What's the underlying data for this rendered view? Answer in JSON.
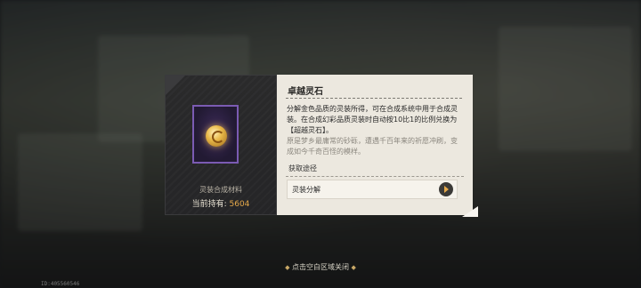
{
  "item": {
    "category": "灵装合成材料",
    "owned_label": "当前持有:",
    "owned_count": "5604",
    "icon": "golden-spirit-stone-icon"
  },
  "info": {
    "title": "卓越灵石",
    "description": "分解金色品质的灵装所得，可在合成系统中用于合成灵装。在合成幻彩品质灵装时自动按10比1的比例兑换为【超越灵石】。",
    "flavor": "原是梦乡最庸常的砂砾，遭遇千百年来的祈愿冲刷，变成如今千奇百怪的模样。",
    "source_title": "获取途径",
    "sources": [
      {
        "label": "灵装分解"
      }
    ]
  },
  "close_hint": "点击空白区域关闭",
  "footer_id": "ID:405560546",
  "colors": {
    "accent": "#e6a94a",
    "rarity_purple": "#7b5bb3",
    "panel_light": "#ece8df",
    "panel_dark": "#2a2a2b"
  }
}
